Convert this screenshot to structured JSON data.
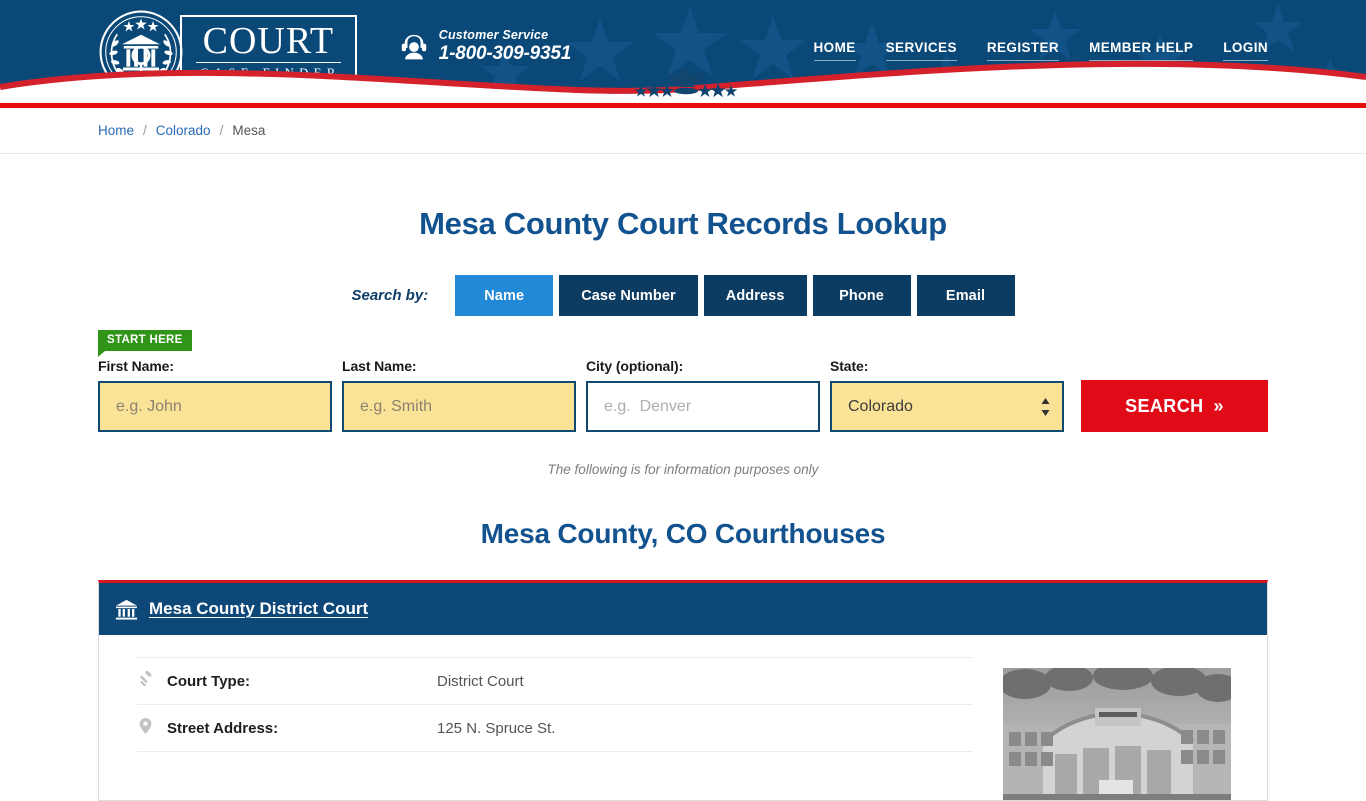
{
  "brand": {
    "logo_main": "COURT",
    "logo_sub": "CASE FINDER",
    "seal_icon": "court-seal-icon"
  },
  "customer_service": {
    "icon": "headset-support-icon",
    "label": "Customer Service",
    "phone": "1-800-309-9351"
  },
  "nav": {
    "items": [
      {
        "label": "HOME"
      },
      {
        "label": "SERVICES"
      },
      {
        "label": "REGISTER"
      },
      {
        "label": "MEMBER HELP"
      },
      {
        "label": "LOGIN"
      }
    ]
  },
  "breadcrumb": {
    "items": [
      {
        "label": "Home",
        "link": true
      },
      {
        "label": "Colorado",
        "link": true
      },
      {
        "label": "Mesa",
        "link": false
      }
    ],
    "separator": "/"
  },
  "main": {
    "page_title": "Mesa County Court Records Lookup",
    "search_by_label": "Search by:",
    "tabs": [
      {
        "label": "Name",
        "active": true
      },
      {
        "label": "Case Number",
        "active": false
      },
      {
        "label": "Address",
        "active": false
      },
      {
        "label": "Phone",
        "active": false
      },
      {
        "label": "Email",
        "active": false
      }
    ],
    "start_badge": "START HERE",
    "fields": {
      "first_name": {
        "label": "First Name:",
        "placeholder": "e.g. John",
        "value": ""
      },
      "last_name": {
        "label": "Last Name:",
        "placeholder": "e.g. Smith",
        "value": ""
      },
      "city": {
        "label": "City (optional):",
        "placeholder": "e.g.  Denver",
        "value": ""
      },
      "state": {
        "label": "State:",
        "selected": "Colorado"
      }
    },
    "search_button": {
      "label": "SEARCH",
      "chevron": "»"
    },
    "info_note": "The following is for information purposes only",
    "section_title": "Mesa County, CO Courthouses"
  },
  "courthouse": {
    "icon": "bank-building-icon",
    "name": "Mesa County District Court",
    "details": [
      {
        "icon": "gavel-icon",
        "label": "Court Type:",
        "value": "District Court"
      },
      {
        "icon": "map-pin-icon",
        "label": "Street Address:",
        "value": "125 N. Spruce St."
      }
    ],
    "photo_alt": "mesa-county-justice-center-photo"
  },
  "colors": {
    "header_blue": "#0a4878",
    "dark_navy": "#0d3c62",
    "active_tab_blue": "#2289d6",
    "accent_red": "#e00b17",
    "rule_red": "#e60d0d",
    "badge_green": "#2f9417",
    "field_yellow": "#fae296",
    "heading_blue": "#12538f",
    "link_blue": "#2a6bb5"
  }
}
